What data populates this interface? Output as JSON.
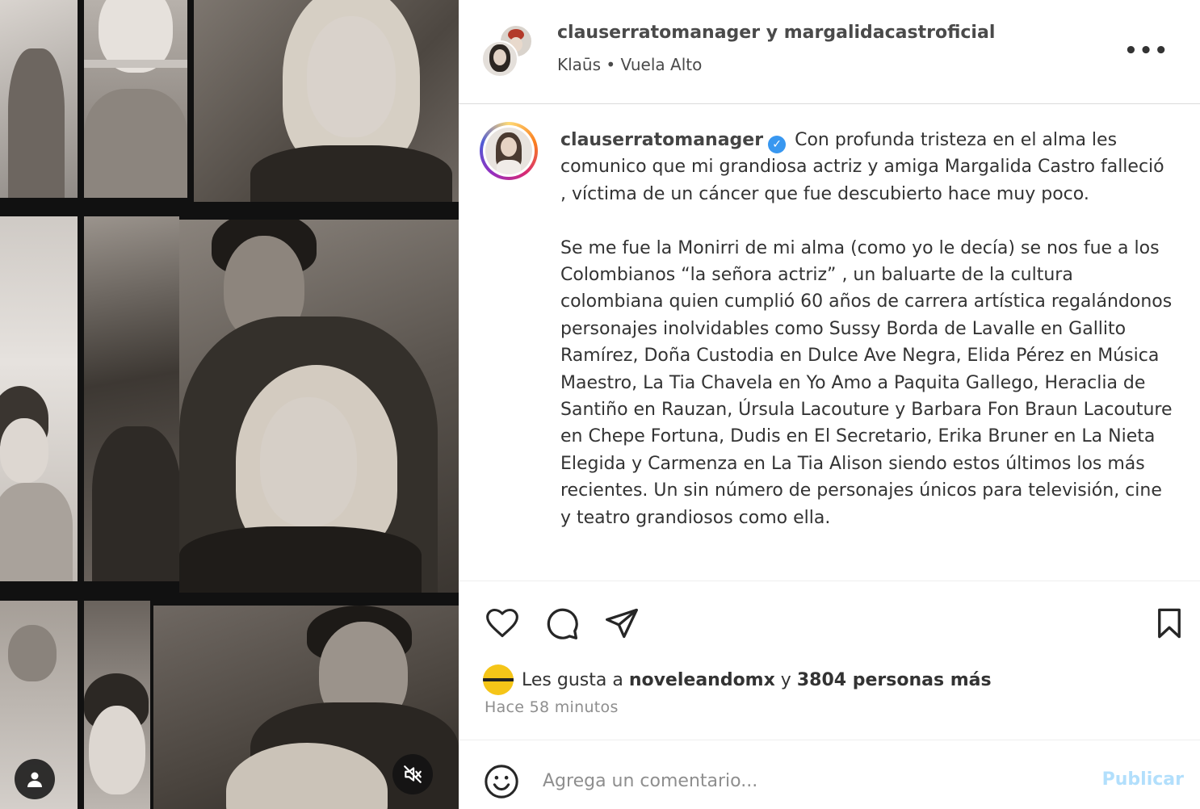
{
  "header": {
    "title": "clauserratomanager y margalidacastroficial",
    "subtitle": "Klaūs • Vuela Alto",
    "more_icon": "more-horizontal-icon"
  },
  "caption": {
    "username": "clauserratomanager",
    "verified": true,
    "paragraph1": "Con profunda tristeza en el alma les comunico que mi grandiosa actriz y amiga Margalida Castro falleció , víctima de un cáncer que fue descubierto hace muy poco.",
    "paragraph2": "Se me fue la Monirri de mi alma (como yo le decía) se nos fue a los Colombianos “la señora actriz” , un baluarte de la cultura colombiana quien cumplió 60 años de carrera artística regalándonos personajes inolvidables como Sussy Borda de Lavalle en Gallito Ramírez, Doña Custodia en Dulce Ave Negra, Elida Pérez en Música Maestro, La Tia Chavela en Yo Amo a Paquita Gallego, Heraclia de Santiño en Rauzan, Úrsula Lacouture y Barbara Fon Braun Lacouture en Chepe Fortuna, Dudis en El Secretario, Erika Bruner en La Nieta Elegida y Carmenza en La Tia Alison siendo estos últimos los más recientes. Un sin número de personajes únicos para televisión, cine y teatro grandiosos como ella."
  },
  "actions": {
    "like_icon": "heart-icon",
    "comment_icon": "comment-icon",
    "share_icon": "send-icon",
    "save_icon": "bookmark-icon"
  },
  "likes": {
    "prefix": "Les gusta a",
    "user": "noveleandomx",
    "connector": "y",
    "others": "3804 personas más"
  },
  "timestamp": "Hace 58 minutos",
  "comment": {
    "placeholder": "Agrega un comentario...",
    "publish_label": "Publicar",
    "emoji_icon": "smiley-icon"
  },
  "media": {
    "user_tag_icon": "user-tag-icon",
    "mute_icon": "muted-speaker-icon"
  },
  "colors": {
    "verified": "#3897f0",
    "publish_disabled": "#b2dffc",
    "muted_text": "#8e8e8e",
    "divider": "#dbdbdb"
  }
}
